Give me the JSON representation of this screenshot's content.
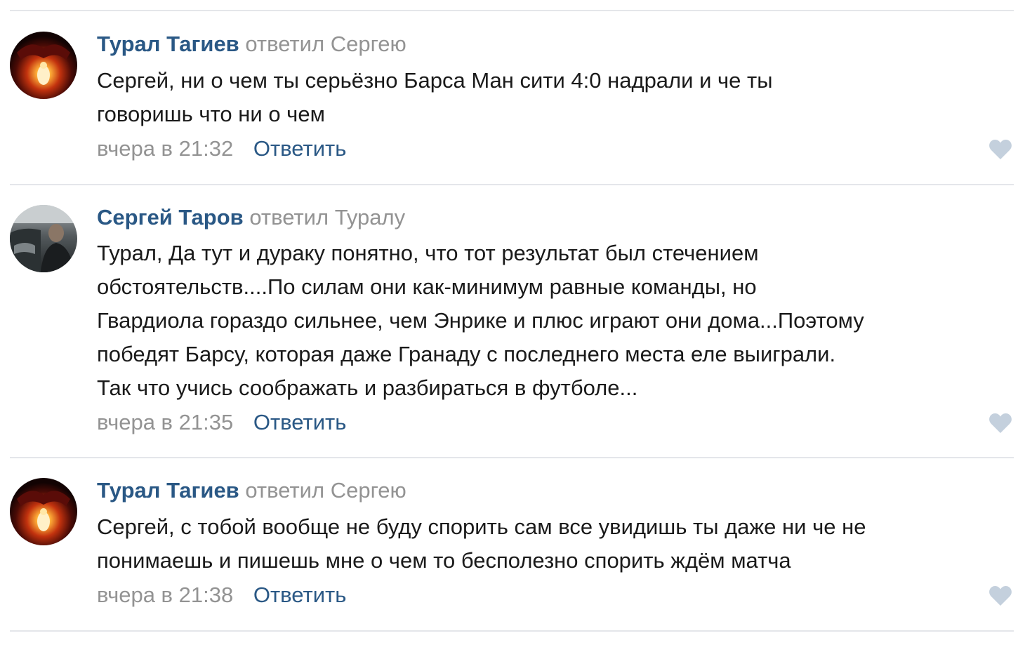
{
  "comments": [
    {
      "author": "Турал Тагиев",
      "reply_action": "ответил",
      "reply_to": "Сергею",
      "lines": [
        "Сергей, ни о чем ты серьёзно Барса Ман сити 4:0 надрали и че ты",
        "говоришь что ни о чем"
      ],
      "time": "вчера в 21:32",
      "reply_label": "Ответить"
    },
    {
      "author": "Сергей Таров",
      "reply_action": "ответил",
      "reply_to": "Туралу",
      "lines": [
        "Турал, Да тут и дураку понятно, что тот результат был стечением",
        "обстоятельств....По силам они как-минимум равные команды, но",
        "Гвардиола гораздо сильнее, чем Энрике и плюс играют они дома...Поэтому",
        "победят Барсу, которая даже Гранаду с последнего места еле выиграли.",
        "Так что учись соображать и разбираться в футболе..."
      ],
      "time": "вчера в 21:35",
      "reply_label": "Ответить"
    },
    {
      "author": "Турал Тагиев",
      "reply_action": "ответил",
      "reply_to": "Сергею",
      "lines": [
        "Сергей, с тобой вообще не буду спорить сам все увидишь ты даже ни че не",
        "понимаешь и пишешь мне о чем то бесполезно спорить ждём матча"
      ],
      "time": "вчера в 21:38",
      "reply_label": "Ответить"
    }
  ],
  "icons": {
    "like": "heart-icon"
  },
  "colors": {
    "author_link": "#2a5885",
    "secondary_text": "#939393",
    "body_text": "#1a1a1a",
    "like_heart": "#c4d0dd",
    "divider": "#e4e6ea"
  }
}
